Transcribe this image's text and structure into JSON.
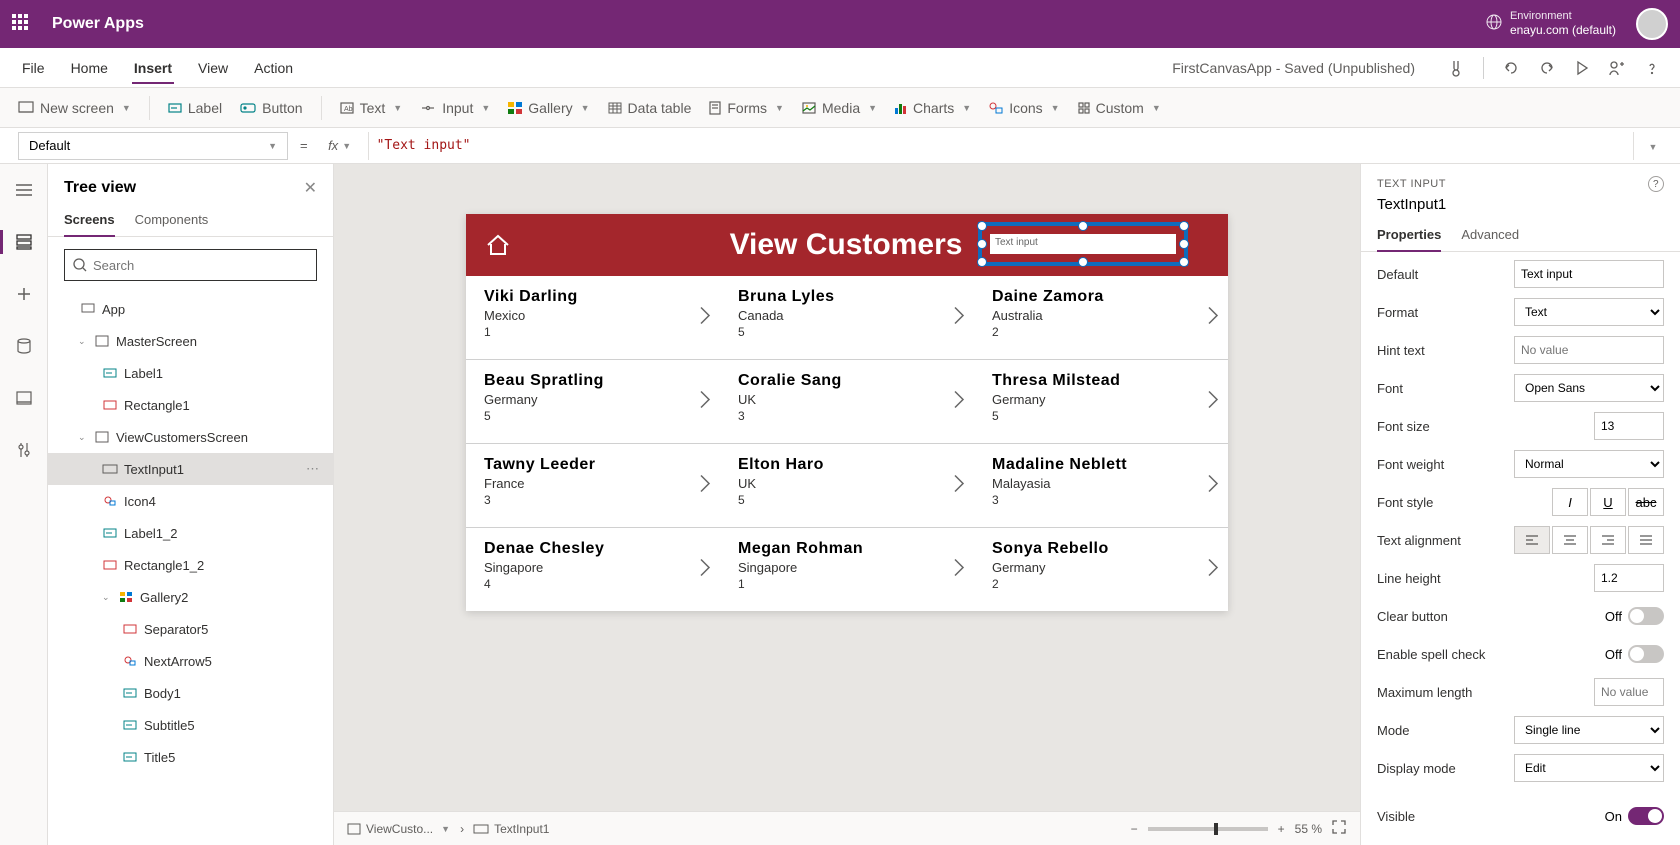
{
  "topbar": {
    "title": "Power Apps",
    "env_label": "Environment",
    "env_value": "enayu.com (default)"
  },
  "menubar": {
    "items": [
      "File",
      "Home",
      "Insert",
      "View",
      "Action"
    ],
    "active": "Insert",
    "status": "FirstCanvasApp - Saved (Unpublished)"
  },
  "ribbon": {
    "new_screen": "New screen",
    "label": "Label",
    "button": "Button",
    "text": "Text",
    "input": "Input",
    "gallery": "Gallery",
    "data_table": "Data table",
    "forms": "Forms",
    "media": "Media",
    "charts": "Charts",
    "icons": "Icons",
    "custom": "Custom"
  },
  "formula_bar": {
    "property": "Default",
    "value": "\"Text input\""
  },
  "tree": {
    "title": "Tree view",
    "tabs": [
      "Screens",
      "Components"
    ],
    "search_placeholder": "Search",
    "nodes": {
      "app": "App",
      "master": "MasterScreen",
      "label1": "Label1",
      "rect1": "Rectangle1",
      "view": "ViewCustomersScreen",
      "textinput1": "TextInput1",
      "icon4": "Icon4",
      "label1_2": "Label1_2",
      "rect1_2": "Rectangle1_2",
      "gallery2": "Gallery2",
      "sep5": "Separator5",
      "next5": "NextArrow5",
      "body1": "Body1",
      "sub5": "Subtitle5",
      "title5": "Title5"
    }
  },
  "canvas": {
    "screen_title": "View Customers",
    "textinput_value": "Text input",
    "customers": [
      [
        {
          "name": "Viki  Darling",
          "country": "Mexico",
          "n": "1"
        },
        {
          "name": "Bruna  Lyles",
          "country": "Canada",
          "n": "5"
        },
        {
          "name": "Daine  Zamora",
          "country": "Australia",
          "n": "2"
        }
      ],
      [
        {
          "name": "Beau  Spratling",
          "country": "Germany",
          "n": "5"
        },
        {
          "name": "Coralie  Sang",
          "country": "UK",
          "n": "3"
        },
        {
          "name": "Thresa  Milstead",
          "country": "Germany",
          "n": "5"
        }
      ],
      [
        {
          "name": "Tawny  Leeder",
          "country": "France",
          "n": "3"
        },
        {
          "name": "Elton  Haro",
          "country": "UK",
          "n": "5"
        },
        {
          "name": "Madaline  Neblett",
          "country": "Malayasia",
          "n": "3"
        }
      ],
      [
        {
          "name": "Denae  Chesley",
          "country": "Singapore",
          "n": "4"
        },
        {
          "name": "Megan  Rohman",
          "country": "Singapore",
          "n": "1"
        },
        {
          "name": "Sonya  Rebello",
          "country": "Germany",
          "n": "2"
        }
      ]
    ],
    "footer": {
      "bc1": "ViewCusto...",
      "bc2": "TextInput1",
      "zoom": "55  %"
    }
  },
  "props": {
    "type_label": "TEXT INPUT",
    "name": "TextInput1",
    "tabs": [
      "Properties",
      "Advanced"
    ],
    "rows": {
      "default_l": "Default",
      "default_v": "Text input",
      "format_l": "Format",
      "format_v": "Text",
      "hint_l": "Hint text",
      "hint_v": "No value",
      "font_l": "Font",
      "font_v": "Open Sans",
      "fontsize_l": "Font size",
      "fontsize_v": "13",
      "fontweight_l": "Font weight",
      "fontweight_v": "Normal",
      "fontstyle_l": "Font style",
      "align_l": "Text alignment",
      "lineheight_l": "Line height",
      "lineheight_v": "1.2",
      "clear_l": "Clear button",
      "clear_v": "Off",
      "spell_l": "Enable spell check",
      "spell_v": "Off",
      "maxlen_l": "Maximum length",
      "maxlen_v": "No value",
      "mode_l": "Mode",
      "mode_v": "Single line",
      "dispmode_l": "Display mode",
      "dispmode_v": "Edit",
      "visible_l": "Visible",
      "visible_v": "On"
    }
  }
}
